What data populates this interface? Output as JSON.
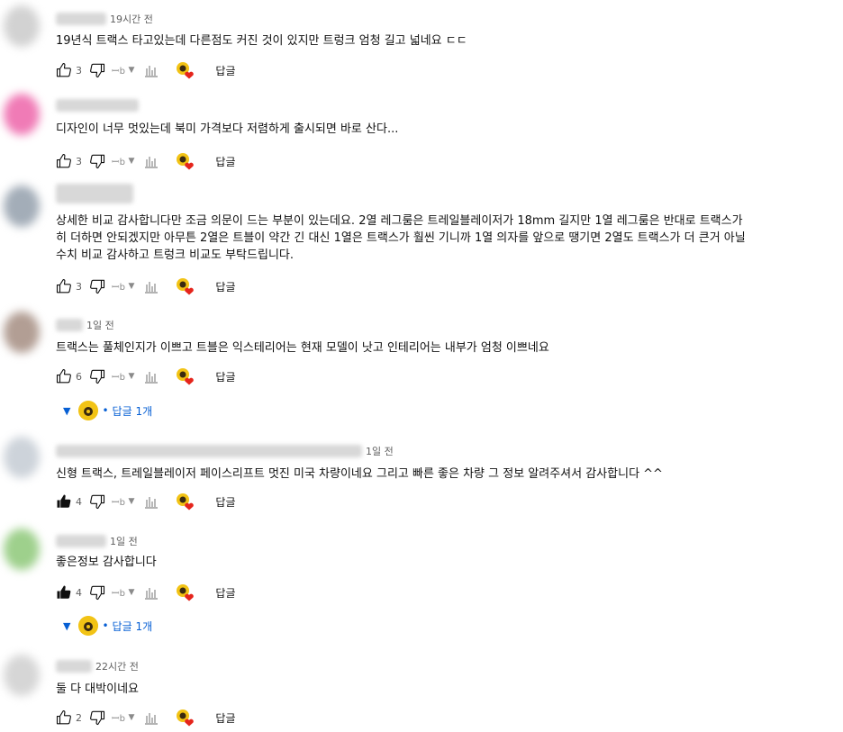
{
  "colors": {
    "link": "#065fd4",
    "meta": "#606060",
    "text": "#0f0f0f",
    "heart": "#e5251c",
    "badge": "#f2c315"
  },
  "icons": {
    "like": "thumb-up-outline-icon",
    "liked": "thumb-up-filled-icon",
    "dislike": "thumb-down-outline-icon",
    "bar": "bar-chart-icon",
    "heart": "creator-heart-icon"
  },
  "labels": {
    "reply": "답글",
    "ext": "ꟷb",
    "ext_arrow": "▼"
  },
  "comments": [
    {
      "time": "19시간 전",
      "text": "19년식 트랙스 타고있는데 다른점도 커진 것이 있지만 트렁크 엄청 길고 넓네요 ㄷㄷ",
      "likes": "3",
      "liked": false
    },
    {
      "time": "",
      "text": "디자인이 너무 멋있는데 북미 가격보다 저렴하게 출시되면 바로 산다...",
      "likes": "3",
      "liked": false
    },
    {
      "time": "",
      "text": "상세한 비교 감사합니다만 조금 의문이 드는 부분이 있는데요. 2열 레그룸은 트레일블레이저가 18mm 길지만 1열 레그룸은 반대로 트랙스가\n히 더하면 안되겠지만 아무튼 2열은 트블이 약간 긴 대신 1열은 트랙스가 훨씬 기니까 1열 의자를 앞으로 땡기면 2열도 트랙스가 더 큰거 아닐\n수치 비교 감사하고 트렁크 비교도 부탁드립니다.",
      "likes": "3",
      "liked": false
    },
    {
      "time": "1일 전",
      "text": "트랙스는 풀체인지가 이쁘고 트블은 익스테리어는 현재 모델이 낫고 인테리어는 내부가 엄청 이쁘네요",
      "likes": "6",
      "liked": false,
      "replies": "답글 1개"
    },
    {
      "time": "1일 전",
      "text": "신형 트랙스, 트레일블레이저 페이스리프트 멋진 미국 차량이네요 그리고 빠른 좋은 차량 그 정보 알려주셔서 감사합니다 ^^",
      "likes": "4",
      "liked": true
    },
    {
      "time": "1일 전",
      "text": "좋은정보 감사합니다",
      "likes": "4",
      "liked": true,
      "replies": "답글 1개"
    },
    {
      "time": "22시간 전",
      "text": "둘 다 대박이네요",
      "likes": "2",
      "liked": false
    }
  ]
}
